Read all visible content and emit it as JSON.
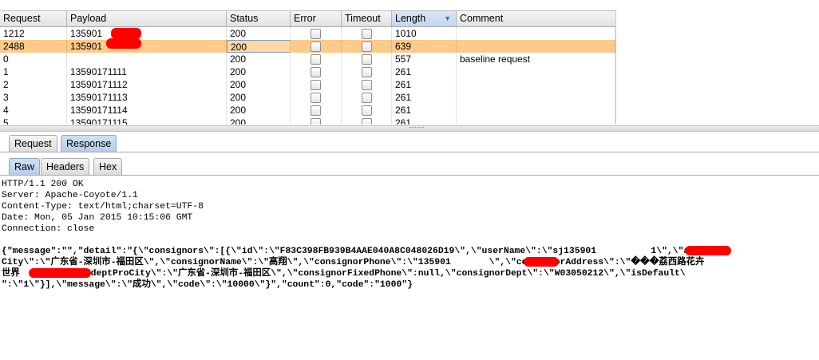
{
  "table": {
    "columns": [
      "Request",
      "Payload",
      "Status",
      "Error",
      "Timeout",
      "Length",
      "Comment"
    ],
    "sorted_column": "Length",
    "sort_direction": "descending",
    "rows": [
      {
        "request": "1212",
        "payload": "135901",
        "status": "200",
        "error": false,
        "timeout": false,
        "length": "1010",
        "comment": "",
        "redacted": true
      },
      {
        "request": "2488",
        "payload": "135901",
        "status": "200",
        "error": false,
        "timeout": false,
        "length": "639",
        "comment": "",
        "redacted": true,
        "selected": true
      },
      {
        "request": "0",
        "payload": "",
        "status": "200",
        "error": false,
        "timeout": false,
        "length": "557",
        "comment": "baseline request"
      },
      {
        "request": "1",
        "payload": "13590171111",
        "status": "200",
        "error": false,
        "timeout": false,
        "length": "261",
        "comment": ""
      },
      {
        "request": "2",
        "payload": "13590171112",
        "status": "200",
        "error": false,
        "timeout": false,
        "length": "261",
        "comment": ""
      },
      {
        "request": "3",
        "payload": "13590171113",
        "status": "200",
        "error": false,
        "timeout": false,
        "length": "261",
        "comment": ""
      },
      {
        "request": "4",
        "payload": "13590171114",
        "status": "200",
        "error": false,
        "timeout": false,
        "length": "261",
        "comment": ""
      },
      {
        "request": "5",
        "payload": "13590171115",
        "status": "200",
        "error": false,
        "timeout": false,
        "length": "261",
        "comment": ""
      }
    ]
  },
  "outer_tabs": {
    "request": "Request",
    "response": "Response",
    "active": "Response"
  },
  "inner_tabs": {
    "raw": "Raw",
    "headers": "Headers",
    "hex": "Hex",
    "active": "Raw"
  },
  "response": {
    "headers": [
      "HTTP/1.1 200 OK",
      "Server: Apache-Coyote/1.1",
      "Content-Type: text/html;charset=UTF-8",
      "Date: Mon, 05 Jan 2015 10:15:06 GMT",
      "Connection: close"
    ],
    "body_lines": [
      "{\"message\":\"\",\"detail\":\"{\\\"consignors\\\":[{\\\"id\\\":\\\"F83C398FB939B4AAE040A8C048026D19\\\",\\\"userName\\\":\\\"sj135901          1\\\",\\\"addrPro",
      "City\\\":\\\"广东省-深圳市-福田区\\\",\\\"consignorName\\\":\\\"高翔\\\",\\\"consignorPhone\\\":\\\"135901       \\\",\\\"consignorAddress\\\":\\\"���荔西路花卉",
      "世界        \\\",\\\"deptProCity\\\":\\\"广东省-深圳市-福田区\\\",\\\"consignorFixedPhone\\\":null,\\\"consignorDept\\\":\\\"W03050212\\\",\\\"isDefault\\",
      "\":\\\"1\\\"}],\\\"message\\\":\\\"成功\\\",\\\"code\\\":\\\"10000\\\"}\",\"count\":0,\"code\":\"1000\"}"
    ]
  },
  "colors": {
    "selected_row": "#fcca8a",
    "redaction": "#ff0000",
    "active_tab": "#b7cde8"
  }
}
